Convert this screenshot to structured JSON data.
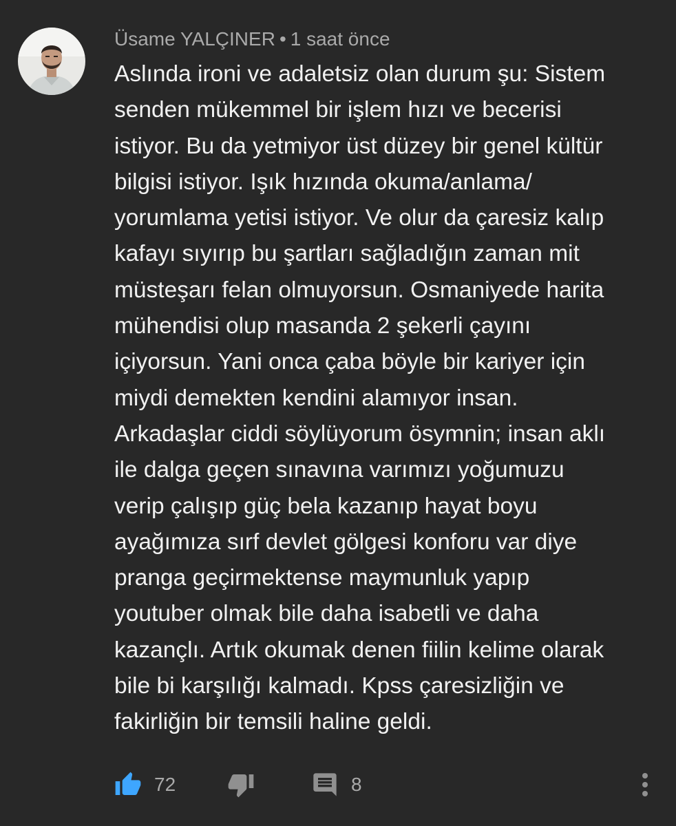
{
  "comment": {
    "author": "Üsame YALÇINER",
    "separator": "•",
    "time": "1 saat önce",
    "avatar_icon": "user-avatar-photo",
    "lines": [
      "Aslında ironi ve adaletsiz olan durum şu: Sistem",
      "senden mükemmel bir işlem hızı ve becerisi",
      "istiyor. Bu da yetmiyor üst düzey bir genel kültür",
      "bilgisi istiyor. Işık hızında okuma/anlama/",
      "yorumlama yetisi istiyor. Ve olur da çaresiz kalıp",
      "kafayı sıyırıp bu şartları sağladığın zaman mit",
      "müsteşarı felan olmuyorsun. Osmaniyede harita",
      "mühendisi olup masanda 2 şekerli çayını",
      "içiyorsun. Yani onca çaba böyle bir kariyer için",
      "miydi demekten kendini alamıyor insan.",
      "Arkadaşlar ciddi söylüyorum ösymnin; insan aklı",
      "ile dalga geçen sınavına varımızı yoğumuzu",
      "verip çalışıp güç bela kazanıp hayat boyu",
      "ayağımıza sırf devlet gölgesi konforu var diye",
      "pranga geçirmektense maymunluk yapıp",
      "youtuber olmak bile daha isabetli ve daha",
      "kazançlı. Artık okumak denen fiilin kelime olarak",
      "bile bi karşılığı kalmadı. Kpss çaresizliğin ve",
      "fakirliğin bir temsili haline geldi."
    ]
  },
  "actions": {
    "like_count": "72",
    "reply_count": "8",
    "like_icon": "thumbs-up-icon",
    "dislike_icon": "thumbs-down-icon",
    "reply_icon": "reply-comment-icon",
    "more_icon": "more-vertical-icon"
  },
  "colors": {
    "background": "#282828",
    "text": "#f1f1f1",
    "meta": "#aaaaaa",
    "like_active": "#3ea6ff",
    "icon": "#909090"
  }
}
